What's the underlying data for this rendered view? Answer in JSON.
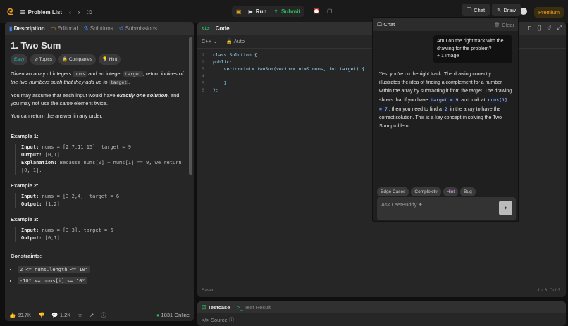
{
  "topbar": {
    "problem_list": "Problem List",
    "run": "Run",
    "submit": "Submit",
    "premium": "Premium"
  },
  "left": {
    "tabs": [
      "Description",
      "Editorial",
      "Solutions",
      "Submissions"
    ],
    "title": "1. Two Sum",
    "difficulty": "Easy",
    "tags": [
      "Topics",
      "Companies",
      "Hint"
    ],
    "desc1_a": "Given an array of integers ",
    "desc1_code1": "nums",
    "desc1_b": " and an integer ",
    "desc1_code2": "target",
    "desc1_c": ", return ",
    "desc1_i": "indices of the two numbers such that they add up to",
    "desc1_code3": "target",
    "desc2_a": "You may assume that each input would have ",
    "desc2_b": "exactly one solution",
    "desc2_c": ", and you may not use the ",
    "desc2_i": "same",
    "desc2_d": " element twice.",
    "desc3": "You can return the answer in any order.",
    "examples": [
      {
        "title": "Example 1:",
        "input": "nums = [2,7,11,15], target = 9",
        "output": "[0,1]",
        "explanation": "Because nums[0] + nums[1] == 9, we return [0, 1]."
      },
      {
        "title": "Example 2:",
        "input": "nums = [3,2,4], target = 6",
        "output": "[1,2]"
      },
      {
        "title": "Example 3:",
        "input": "nums = [3,3], target = 6",
        "output": "[0,1]"
      }
    ],
    "input_label": "Input:",
    "output_label": "Output:",
    "explanation_label": "Explanation:",
    "constraints_title": "Constraints:",
    "constraints": [
      "2 <= nums.length <= 10⁴",
      "-10⁹ <= nums[i] <= 10⁹"
    ],
    "likes": "59.7K",
    "comments": "1.2K",
    "online": "1831 Online"
  },
  "code": {
    "title": "Code",
    "language": "C++",
    "mode": "Auto",
    "lines": [
      "class Solution {",
      "public:",
      "    vector<int> twoSum(vector<int>& nums, int target) {",
      "",
      "    }",
      "};"
    ],
    "saved": "Saved",
    "cursor": "Ln 6, Col 3"
  },
  "bottom": {
    "testcase": "Testcase",
    "test_result": "Test Result",
    "source": "Source"
  },
  "chat": {
    "tab_chat": "Chat",
    "tab_draw": "Draw",
    "header": "Chat",
    "clear": "Clear",
    "user_msg": "Am I on the right track with the drawing for the problem?",
    "user_attach": "+ 1 Image",
    "reply_a": "Yes, you're on the right track. The drawing correctly illustrates the idea of finding a complement for a number within the array by subtracting it from the target. The drawing shows that if you have ",
    "reply_c1": "target = 9",
    "reply_b": " and look at ",
    "reply_c2": "nums[1] = 7",
    "reply_c": ", then you need to find a ",
    "reply_c3": "2",
    "reply_d": " in the array to have the correct solution. This is a key concept in solving the Two Sum problem.",
    "chips": [
      "Edge Cases",
      "Complexity",
      "Hint",
      "Bug"
    ],
    "placeholder": "Ask LeetBuddy ✦"
  }
}
